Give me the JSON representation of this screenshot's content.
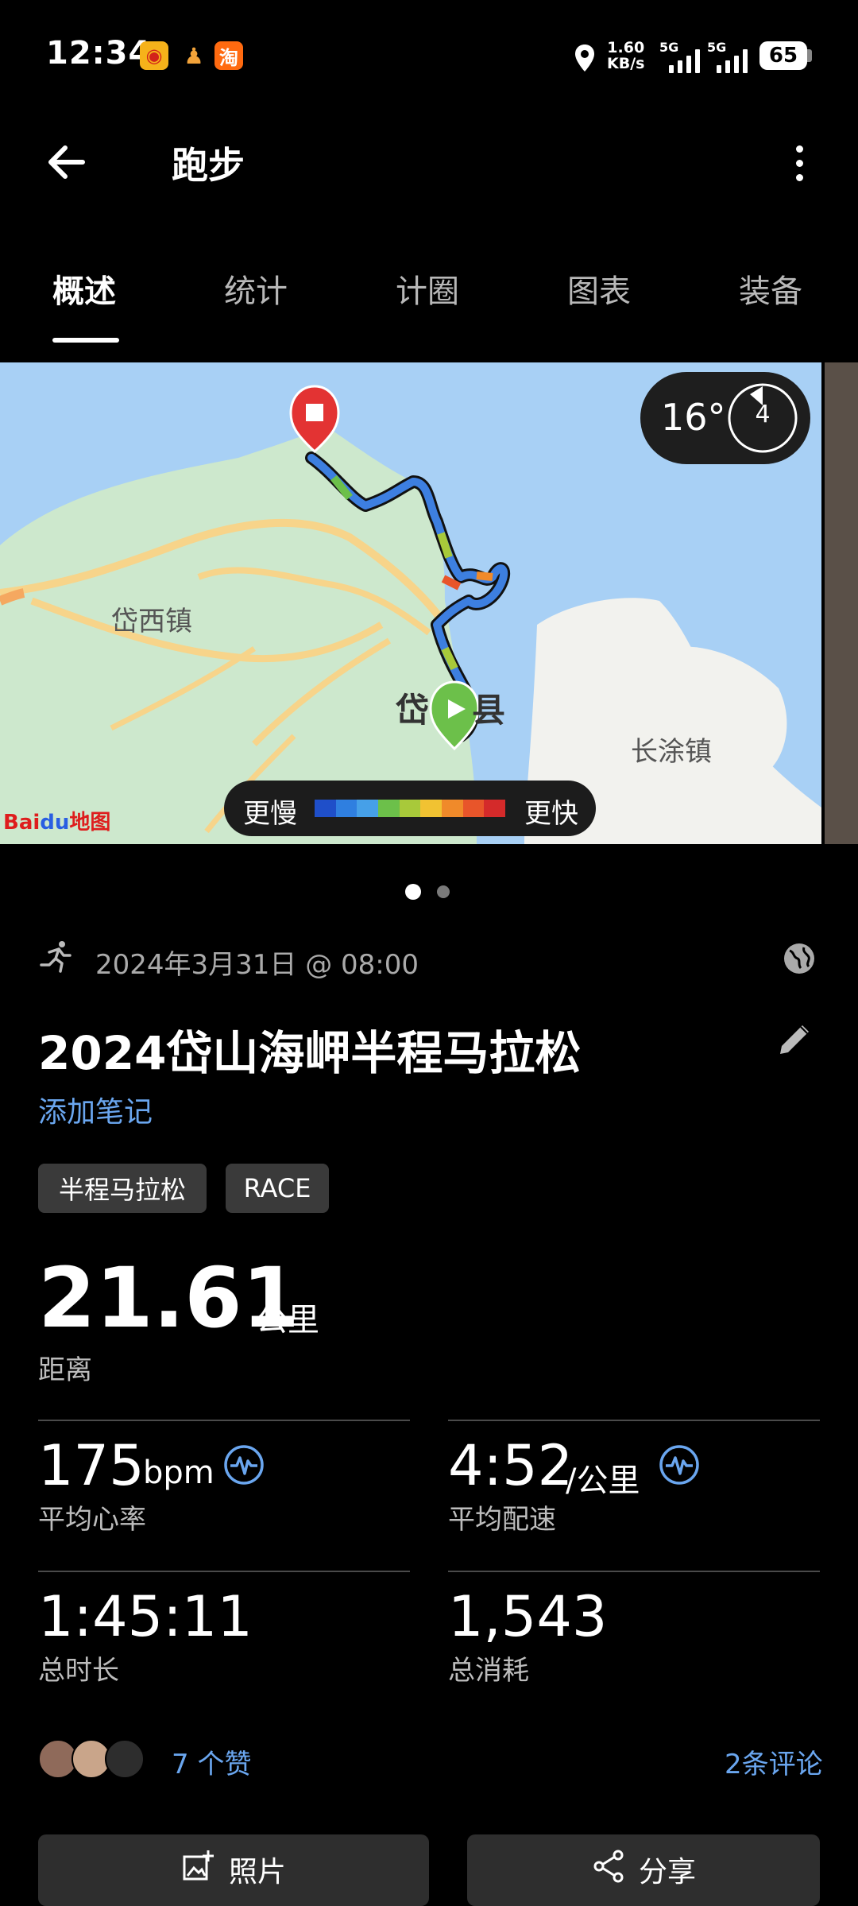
{
  "status_bar": {
    "time": "12:34",
    "notif_weibo": "◉",
    "notif_app2": "♟",
    "notif_taobao": "淘",
    "net_speed_value": "1.60",
    "net_speed_unit": "KB/s",
    "sim1": "5G",
    "sim2": "5G",
    "battery": "65",
    "icons": [
      "location-icon",
      "signal-icon",
      "battery-icon"
    ]
  },
  "header": {
    "title": "跑步",
    "back_icon": "arrow-left-icon",
    "more_icon": "more-vertical-icon"
  },
  "tabs": [
    {
      "label": "概述",
      "active": true
    },
    {
      "label": "统计",
      "active": false
    },
    {
      "label": "计圈",
      "active": false
    },
    {
      "label": "图表",
      "active": false
    },
    {
      "label": "装备",
      "active": false
    }
  ],
  "map": {
    "place_labels": [
      "岱西镇",
      "岱",
      "县",
      "长涂镇"
    ],
    "weather_temp": "16°",
    "wind_speed": "4",
    "legend_slow": "更慢",
    "legend_fast": "更快",
    "legend_colors": [
      "#1f4fc9",
      "#2f7fe0",
      "#46a0e8",
      "#6cc04a",
      "#a8c93a",
      "#f1c232",
      "#f08a2a",
      "#e8552a",
      "#d42a2a"
    ],
    "provider_logo": "Baidu地图",
    "provider_logo_parts": {
      "a": "Bai",
      "b": "du",
      "c": "地图"
    },
    "pages": 2,
    "current_page": 1
  },
  "activity": {
    "type_icon": "running-icon",
    "date": "2024年3月31日 @ 08:00",
    "privacy_icon": "globe-icon",
    "title": "2024岱山海岬半程马拉松",
    "add_note": "添加笔记",
    "tags": [
      "半程马拉松",
      "RACE"
    ]
  },
  "metrics": {
    "distance": {
      "value": "21.61",
      "unit": "公里",
      "label": "距离"
    },
    "avg_hr": {
      "value": "175",
      "unit": "bpm",
      "label": "平均心率"
    },
    "avg_pace": {
      "value": "4:52",
      "unit": "/公里",
      "label": "平均配速"
    },
    "total_time": {
      "value": "1:45:11",
      "label": "总时长"
    },
    "calories": {
      "value": "1,543",
      "label": "总消耗"
    }
  },
  "social": {
    "likes": "7 个赞",
    "comments": "2条评论"
  },
  "actions": {
    "photo": "照片",
    "share": "分享"
  }
}
